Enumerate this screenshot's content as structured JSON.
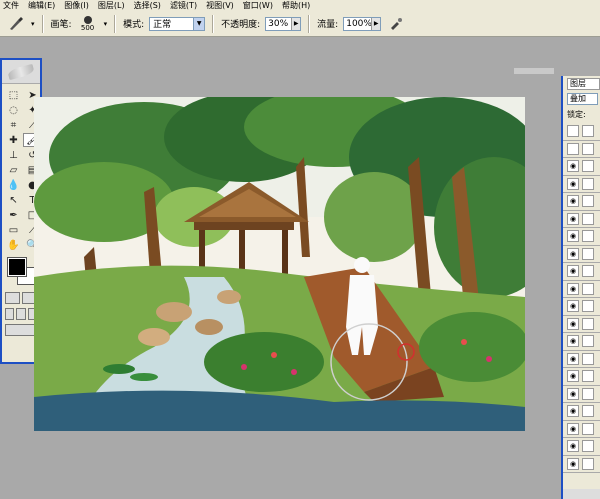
{
  "menu": [
    "文件",
    "编辑(E)",
    "图像(I)",
    "图层(L)",
    "选择(S)",
    "滤镜(T)",
    "视图(V)",
    "窗口(W)",
    "帮助(H)"
  ],
  "options": {
    "brush_label": "画笔:",
    "brush_size": "500",
    "mode_label": "模式:",
    "mode_value": "正常",
    "opacity_label": "不透明度:",
    "opacity_value": "30%",
    "flow_label": "流量:",
    "flow_value": "100%"
  },
  "icons": {
    "brush_tool": "brush-icon",
    "airbrush": "airbrush-icon"
  },
  "layers": {
    "tab": "图层",
    "blend_mode": "叠加",
    "lock_label": "锁定:"
  },
  "colors": {
    "foreground": "#000000",
    "background": "#ffffff",
    "accent": "#1d4fc4"
  }
}
